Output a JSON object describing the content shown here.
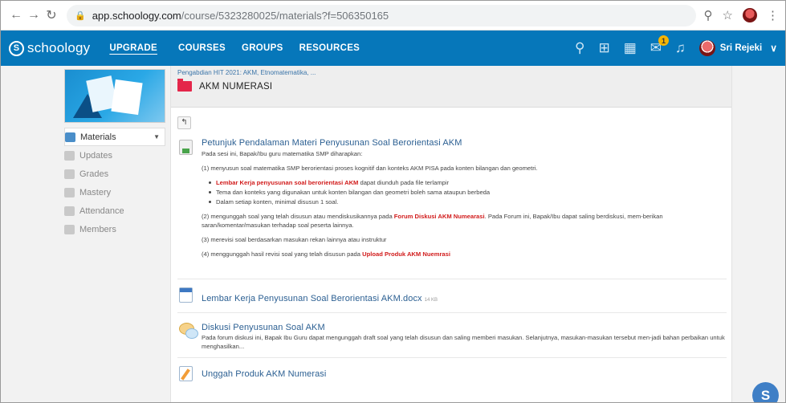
{
  "browser": {
    "url_host": "app.schoology.com",
    "url_path": "/course/5323280025/materials?f=506350165"
  },
  "topnav": {
    "logo_text": "schoology",
    "upgrade": "UPGRADE",
    "courses": "COURSES",
    "groups": "GROUPS",
    "resources": "RESOURCES",
    "message_badge": "1",
    "user_name": "Sri Rejeki"
  },
  "sidebar": {
    "items": [
      {
        "label": "Materials"
      },
      {
        "label": "Updates"
      },
      {
        "label": "Grades"
      },
      {
        "label": "Mastery"
      },
      {
        "label": "Attendance"
      },
      {
        "label": "Members"
      }
    ]
  },
  "header": {
    "breadcrumb": "Pengabdian HIT 2021: AKM, Etnomatematika, ...",
    "title": "AKM NUMERASI"
  },
  "items": {
    "i1": {
      "title": "Petunjuk Pendalaman Materi Penyusunan Soal Berorientasi AKM",
      "intro": "Pada sesi ini, Bapak/Ibu guru matematika SMP diharapkan:",
      "p1": "(1) menyusun soal matematika SMP berorientasi proses kognitif dan konteks AKM PISA pada konten bilangan dan geometri.",
      "b1_link": "Lembar Kerja penyusunan soal berorientasi AKM",
      "b1_rest": " dapat diunduh pada file terlampir",
      "b2": "Tema dan konteks yang digunakan untuk konten bilangan dan geometri boleh sama ataupun berbeda",
      "b3": "Dalam setiap konten, minimal disusun 1 soal.",
      "p2_a": "(2) mengunggah soal yang telah disusun atau mendiskusikannya pada ",
      "p2_link": "Forum Diskusi AKM Numearasi",
      "p2_b": ". Pada Forum ini, Bapak/Ibu dapat saling berdiskusi, mem-berikan saran/komentar/masukan terhadap soal peserta lainnya.",
      "p3": "(3) merevisi soal berdasarkan masukan rekan lainnya atau instruktur",
      "p4_a": "(4) menggunggah hasil revisi soal yang telah disusun pada ",
      "p4_link": "Upload Produk AKM Nuemrasi"
    },
    "i2": {
      "title": "Lembar Kerja Penyusunan Soal Berorientasi AKM.docx",
      "size": "14 KB"
    },
    "i3": {
      "title": "Diskusi Penyusunan Soal AKM",
      "text": "Pada forum diskusi ini, Bapak Ibu Guru dapat mengunggah draft soal yang telah disusun dan saling memberi masukan. Selanjutnya, masukan-masukan tersebut men-jadi bahan perbaikan untuk menghasilkan..."
    },
    "i4": {
      "title": "Unggah Produk AKM Numerasi"
    }
  },
  "help_label": "S",
  "icons": [
    "back-arrow-icon",
    "forward-arrow-icon",
    "reload-icon",
    "lock-icon",
    "zoom-icon",
    "star-icon",
    "search-icon",
    "apps-grid-icon",
    "calendar-icon",
    "mail-icon",
    "bell-icon",
    "chevron-down-icon",
    "folder-icon",
    "page-icon",
    "doc-file-icon",
    "discussion-icon",
    "assignment-icon"
  ],
  "colors": {
    "brand": "#0677ba",
    "link": "#2b5f92",
    "red_link": "#d11b1b",
    "folder": "#e4264a"
  }
}
